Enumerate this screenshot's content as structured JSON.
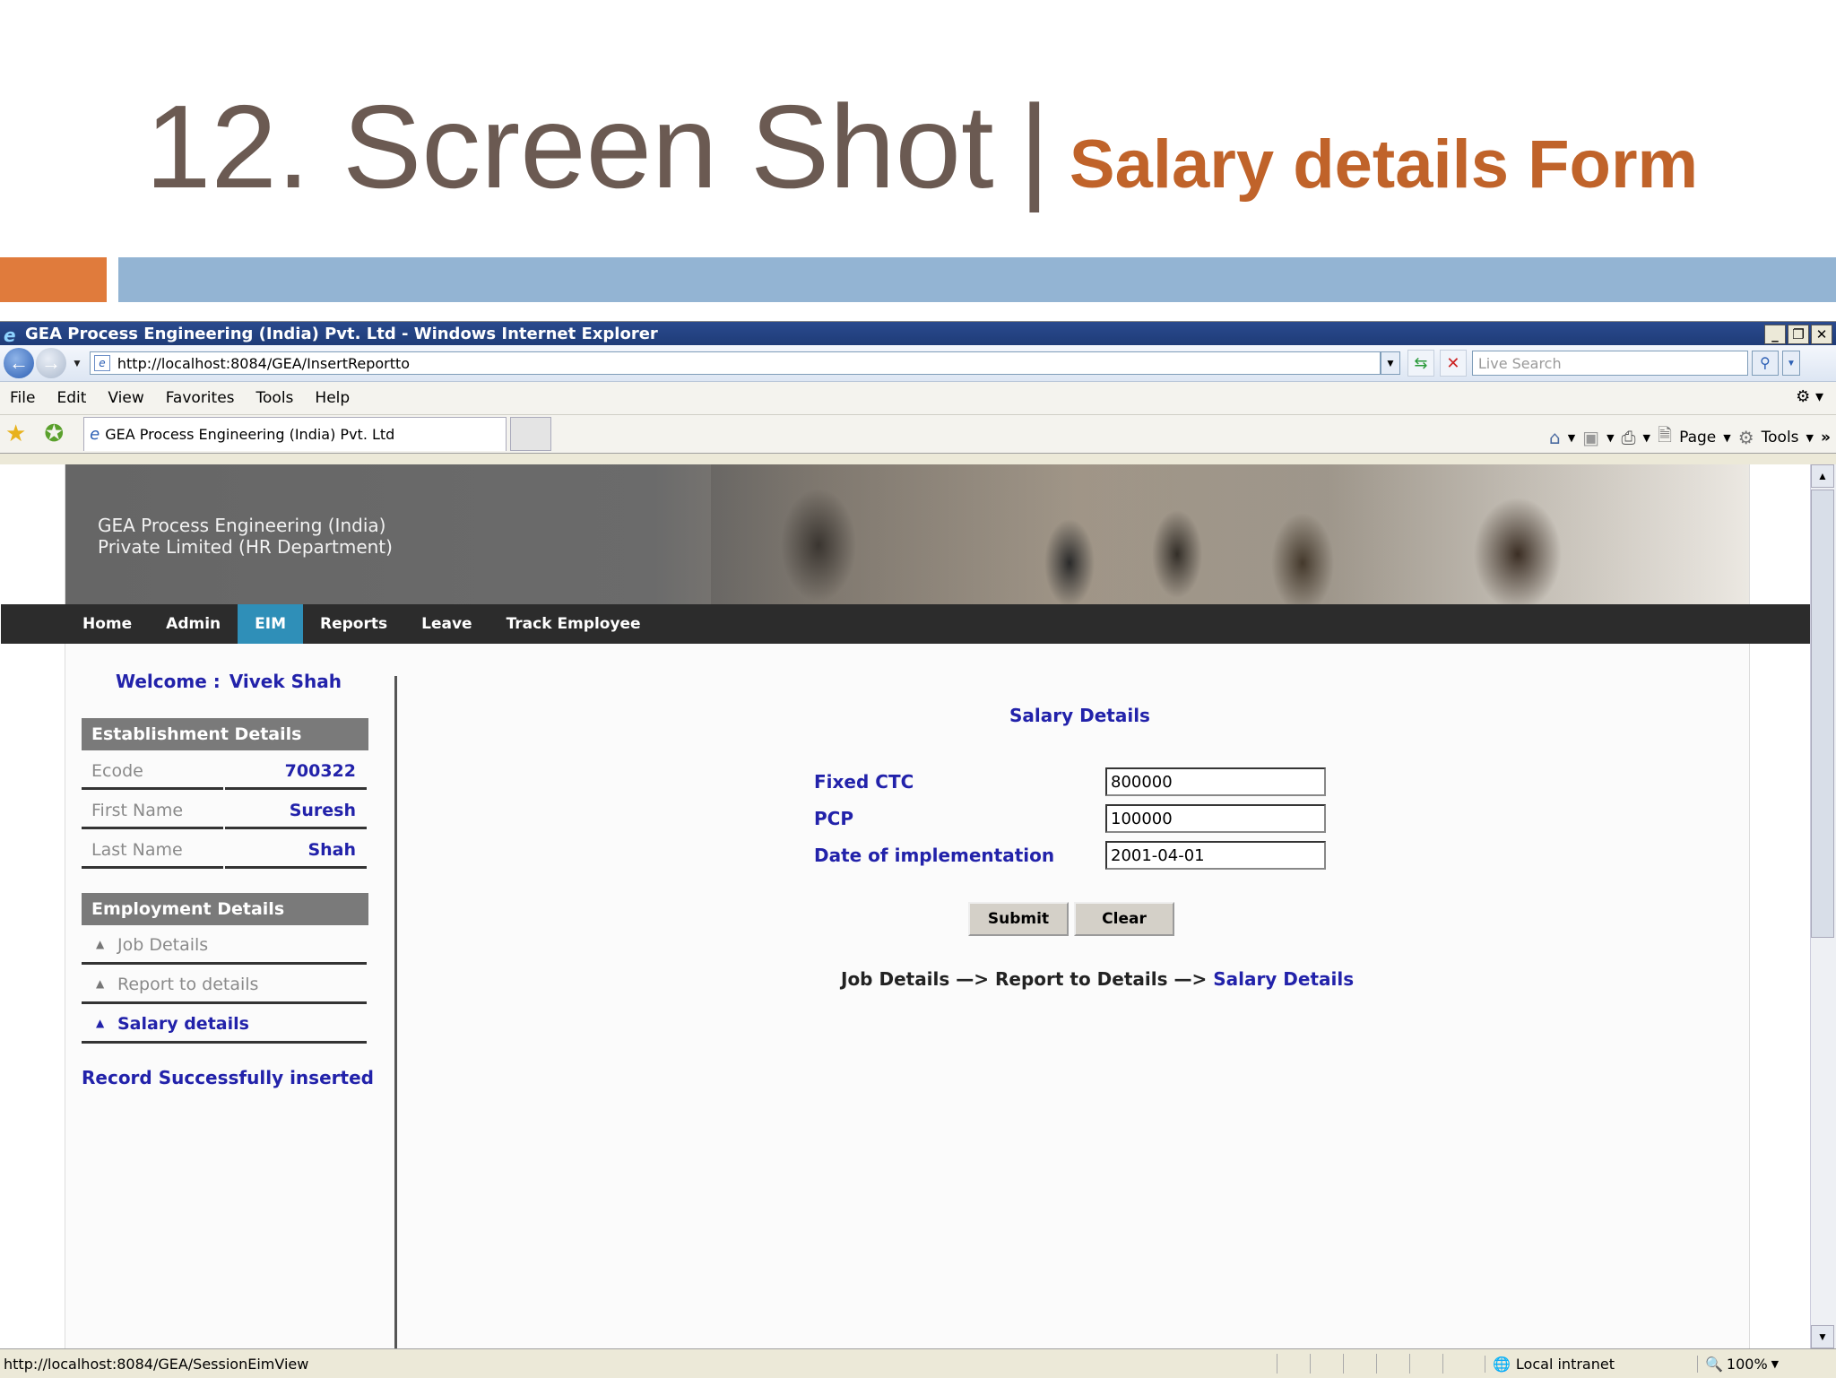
{
  "slide": {
    "title_main": "12. Screen Shot",
    "separator": "|",
    "title_sub": "Salary details Form"
  },
  "window": {
    "title": "GEA Process Engineering (India) Pvt. Ltd - Windows Internet Explorer",
    "buttons": [
      "_",
      "❐",
      "✕"
    ]
  },
  "address_bar": {
    "url": "http://localhost:8084/GEA/InsertReportto",
    "search_placeholder": "Live Search"
  },
  "menu": [
    "File",
    "Edit",
    "View",
    "Favorites",
    "Tools",
    "Help"
  ],
  "tab": {
    "title": "GEA Process Engineering (India) Pvt. Ltd"
  },
  "command_bar": {
    "page_label": "Page",
    "tools_label": "Tools"
  },
  "site": {
    "company_line1": "GEA Process Engineering (India)",
    "company_line2": "Private Limited (HR Department)",
    "nav": [
      "Home",
      "Admin",
      "EIM",
      "Reports",
      "Leave",
      "Track Employee"
    ],
    "active_nav": "EIM"
  },
  "sidebar": {
    "welcome_label": "Welcome :",
    "user_name": "Vivek Shah",
    "establishment_title": "Establishment Details",
    "fields": [
      {
        "label": "Ecode",
        "value": "700322"
      },
      {
        "label": "First Name",
        "value": "Suresh"
      },
      {
        "label": "Last Name",
        "value": "Shah"
      }
    ],
    "employment_title": "Employment Details",
    "links": [
      "Job Details",
      "Report to details",
      "Salary details"
    ],
    "active_link": "Salary details",
    "message": "Record Successfully inserted"
  },
  "form": {
    "title": "Salary Details",
    "fields": [
      {
        "label": "Fixed CTC",
        "value": "800000"
      },
      {
        "label": "PCP",
        "value": "100000"
      },
      {
        "label": "Date of implementation",
        "value": "2001-04-01"
      }
    ],
    "submit_label": "Submit",
    "clear_label": "Clear",
    "breadcrumb_prefix": "Job Details —> Report to Details —>",
    "breadcrumb_current": "Salary Details"
  },
  "status_bar": {
    "url": "http://localhost:8084/GEA/SessionEimView",
    "zone": "Local intranet",
    "zoom": "100%"
  },
  "colors": {
    "title_text": "#6b5a52",
    "subtitle_text": "#c0632a",
    "band_orange": "#e07b3c",
    "band_blue": "#93b4d3",
    "nav_active": "#2f8fb8",
    "link_blue": "#2222aa"
  }
}
